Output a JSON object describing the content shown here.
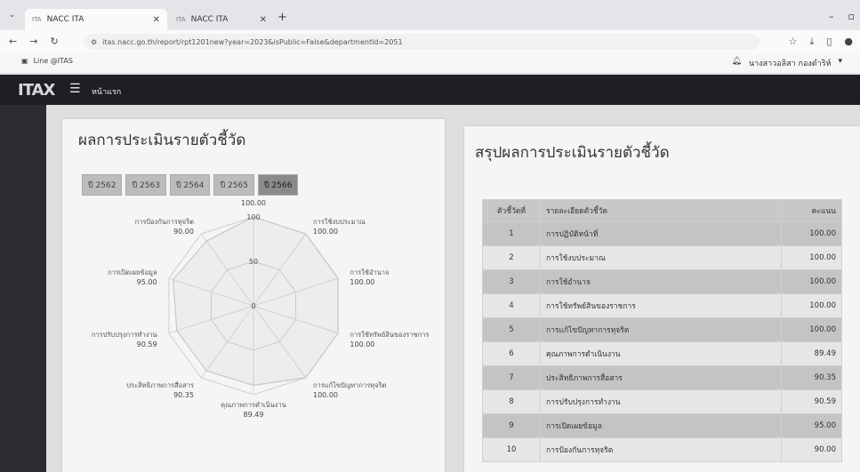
{
  "browser": {
    "tabs": [
      {
        "title": "NACC ITA",
        "active": true
      },
      {
        "title": "NACC ITA",
        "active": false
      }
    ],
    "url": "itas.nacc.go.th/report/rpt1201new?year=2023&isPublic=False&departmentId=2051",
    "bookmark": "Line @ITAS",
    "user": "นางสาวอลิสา กองดำริห์"
  },
  "app": {
    "logo": "ITAX",
    "home_label": "หน้าแรก"
  },
  "left_card": {
    "title": "ผลการประเมินรายตัวชี้วัด",
    "years": [
      "ปี 2562",
      "ปี 2563",
      "ปี 2564",
      "ปี 2565",
      "ปี 2566"
    ],
    "selected_year": "ปี 2566",
    "radar_ticks": [
      "0",
      "50",
      "100"
    ]
  },
  "chart_data": {
    "type": "radar",
    "rmax": 100,
    "ticks": [
      0,
      50,
      100
    ],
    "axes": [
      {
        "label": "การปฏิบัติหน้าที่",
        "value": 100.0
      },
      {
        "label": "การใช้งบประมาณ",
        "value": 100.0
      },
      {
        "label": "การใช้อำนาจ",
        "value": 100.0
      },
      {
        "label": "การใช้ทรัพย์สินของราชการ",
        "value": 100.0
      },
      {
        "label": "การแก้ไขปัญหาการทุจริต",
        "value": 100.0
      },
      {
        "label": "คุณภาพการดำเนินงาน",
        "value": 89.49
      },
      {
        "label": "ประสิทธิภาพการสื่อสาร",
        "value": 90.35
      },
      {
        "label": "การปรับปรุงการทำงาน",
        "value": 90.59
      },
      {
        "label": "การเปิดเผยข้อมูล",
        "value": 95.0
      },
      {
        "label": "การป้องกันการทุจริต",
        "value": 90.0
      }
    ]
  },
  "right_card": {
    "title": "สรุปผลการประเมินรายตัวชี้วัด",
    "headers": [
      "ตัวชี้วัดที่",
      "รายละเอียดตัวชี้วัด",
      "คะแนน"
    ],
    "rows": [
      {
        "no": "1",
        "name": "การปฏิบัติหน้าที่",
        "score": "100.00"
      },
      {
        "no": "2",
        "name": "การใช้งบประมาณ",
        "score": "100.00"
      },
      {
        "no": "3",
        "name": "การใช้อำนาจ",
        "score": "100.00"
      },
      {
        "no": "4",
        "name": "การใช้ทรัพย์สินของราชการ",
        "score": "100.00"
      },
      {
        "no": "5",
        "name": "การแก้ไขปัญหาการทุจริต",
        "score": "100.00"
      },
      {
        "no": "6",
        "name": "คุณภาพการดำเนินงาน",
        "score": "89.49"
      },
      {
        "no": "7",
        "name": "ประสิทธิภาพการสื่อสาร",
        "score": "90.35"
      },
      {
        "no": "8",
        "name": "การปรับปรุงการทำงาน",
        "score": "90.59"
      },
      {
        "no": "9",
        "name": "การเปิดเผยข้อมูล",
        "score": "95.00"
      },
      {
        "no": "10",
        "name": "การป้องกันการทุจริต",
        "score": "90.00"
      }
    ]
  }
}
